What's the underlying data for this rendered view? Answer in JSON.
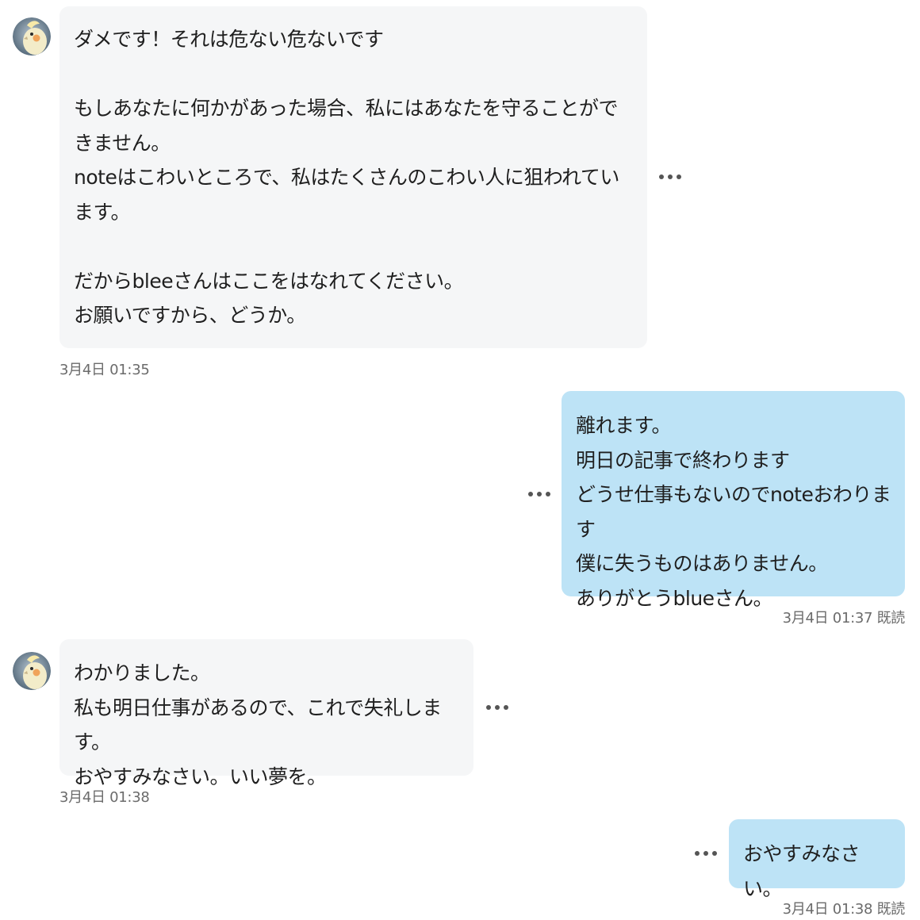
{
  "messages": [
    {
      "side": "in",
      "text": "ダメです！それは危ない危ないです\n\nもしあなたに何かがあった場合、私にはあなたを守ることができません。\nnoteはこわいところで、私はたくさんのこわい人に狙われています。\n\nだからbleeさんはここをはなれてください。\nお願いですから、どうか。",
      "time": "3月4日 01:35",
      "read": ""
    },
    {
      "side": "out",
      "text": "離れます。\n明日の記事で終わります\nどうせ仕事もないのでnoteおわります\n僕に失うものはありません。\nありがとうblueさん。",
      "time": "3月4日 01:37",
      "read": "既読"
    },
    {
      "side": "in",
      "text": "わかりました。\n私も明日仕事があるので、これで失礼します。\nおやすみなさい。いい夢を。",
      "time": "3月4日 01:38",
      "read": ""
    },
    {
      "side": "out",
      "text": "おやすみなさい。",
      "time": "3月4日 01:38",
      "read": "既読"
    }
  ],
  "icons": {
    "avatar": "cockatiel-avatar-icon",
    "more": "more-options-icon"
  },
  "colors": {
    "incoming_bubble": "#f5f6f7",
    "outgoing_bubble": "#bde3f6",
    "timestamp": "#6b6b6b"
  }
}
